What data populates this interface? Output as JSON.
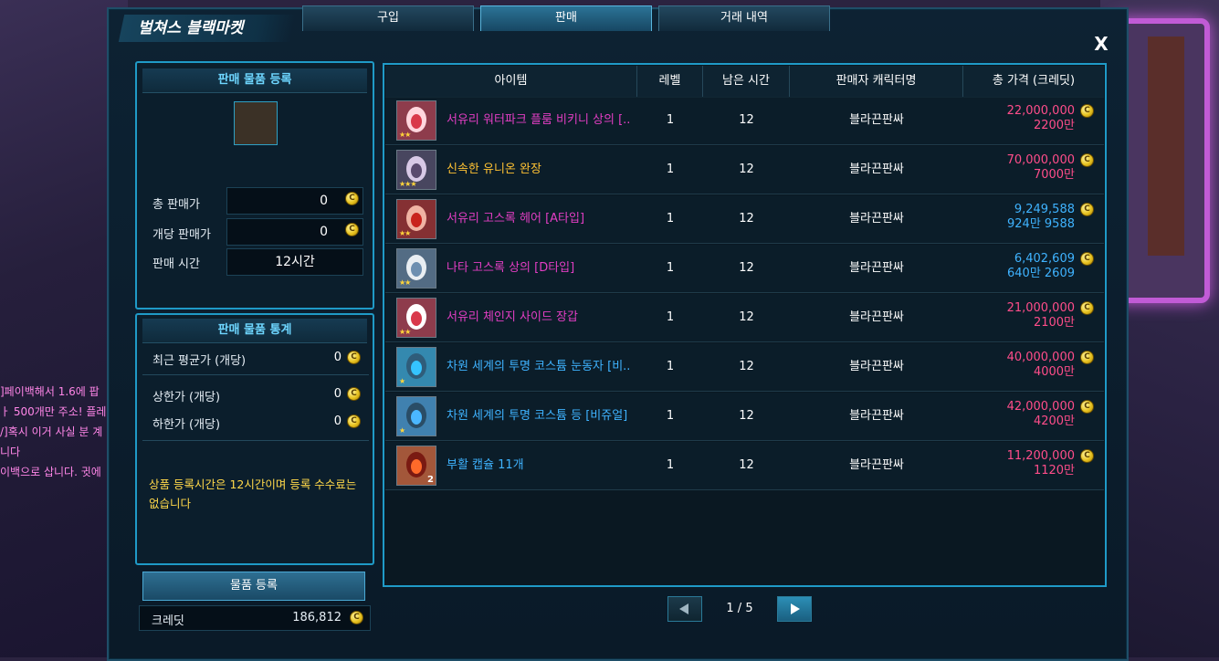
{
  "chat": [
    {
      "text": "]페이백해서 1.6에 팝",
      "pink": true
    },
    {
      "text": "ㅏ 500개만 주소! 플레",
      "pink": false
    },
    {
      "text": "/]혹시 이거 사실 분 계",
      "pink": false
    },
    {
      "text": "니다",
      "pink": false
    },
    {
      "text": "이백으로 삽니다. 귓에",
      "pink": false
    }
  ],
  "window": {
    "title": "벌쳐스 블랙마켓",
    "close": "X"
  },
  "tabs": [
    "구입",
    "판매",
    "거래 내역"
  ],
  "register": {
    "header": "판매 물품 등록",
    "total_price_label": "총 판매가",
    "total_price": "0",
    "unit_price_label": "개당 판매가",
    "unit_price": "0",
    "sale_time_label": "판매 시간",
    "sale_time": "12시간"
  },
  "stats": {
    "header": "판매 물품 통계",
    "recent_avg_label": "최근 평균가 (개당)",
    "recent_avg": "0",
    "upper_label": "상한가 (개당)",
    "upper": "0",
    "lower_label": "하한가 (개당)",
    "lower": "0"
  },
  "notice": "상품 등록시간은 12시간이며 등록 수수료는 없습니다",
  "register_button": "물품 등록",
  "credit": {
    "label": "크레딧",
    "value": "186,812"
  },
  "coin_glyph": "C",
  "table": {
    "headers": [
      "아이템",
      "레벨",
      "남은 시간",
      "판매자 캐릭터명",
      "총 가격 (크레딧)"
    ],
    "rows": [
      {
        "name": "서유리 워터파크 플룸 비키니 상의 [..",
        "name_color": "#e33ec4",
        "level": "1",
        "time": "12",
        "seller": "블라끈판싸",
        "price": "22,000,000",
        "price_short": "2200만",
        "price_color": "#ff4d8a",
        "icon": "bikini-top-icon",
        "stars": "★★",
        "qty": ""
      },
      {
        "name": "신속한 유니온 완장",
        "name_color": "#ffc233",
        "level": "1",
        "time": "12",
        "seller": "블라끈판싸",
        "price": "70,000,000",
        "price_short": "7000만",
        "price_color": "#ff4d8a",
        "icon": "armband-icon",
        "stars": "★★★",
        "qty": ""
      },
      {
        "name": "서유리 고스록 헤어 [A타입]",
        "name_color": "#e33ec4",
        "level": "1",
        "time": "12",
        "seller": "블라끈판싸",
        "price": "9,249,588",
        "price_short": "924만 9588",
        "price_color": "#3fb3ff",
        "icon": "red-hair-icon",
        "stars": "★★",
        "qty": ""
      },
      {
        "name": "나타 고스록 상의 [D타입]",
        "name_color": "#e33ec4",
        "level": "1",
        "time": "12",
        "seller": "블라끈판싸",
        "price": "6,402,609",
        "price_short": "640만 2609",
        "price_color": "#3fb3ff",
        "icon": "white-top-icon",
        "stars": "★★",
        "qty": ""
      },
      {
        "name": "서유리 체인지 사이드 장갑",
        "name_color": "#e33ec4",
        "level": "1",
        "time": "12",
        "seller": "블라끈판싸",
        "price": "21,000,000",
        "price_short": "2100만",
        "price_color": "#ff4d8a",
        "icon": "glove-icon",
        "stars": "★★",
        "qty": ""
      },
      {
        "name": "차원 세계의 투명 코스튬 눈동자 [비..",
        "name_color": "#3fb3ff",
        "level": "1",
        "time": "12",
        "seller": "블라끈판싸",
        "price": "40,000,000",
        "price_short": "4000만",
        "price_color": "#ff4d8a",
        "icon": "eye-costume-icon",
        "stars": "★",
        "qty": ""
      },
      {
        "name": "차원 세계의 투명 코스튬 등 [비쥬얼]",
        "name_color": "#3fb3ff",
        "level": "1",
        "time": "12",
        "seller": "블라끈판싸",
        "price": "42,000,000",
        "price_short": "4200만",
        "price_color": "#ff4d8a",
        "icon": "back-costume-icon",
        "stars": "★",
        "qty": ""
      },
      {
        "name": "부활 캡슐 11개",
        "name_color": "#3fb3ff",
        "level": "1",
        "time": "12",
        "seller": "블라끈판싸",
        "price": "11,200,000",
        "price_short": "1120만",
        "price_color": "#ff4d8a",
        "icon": "revive-capsule-icon",
        "stars": "",
        "qty": "2"
      }
    ]
  },
  "pager": {
    "text": "1 / 5",
    "prev": "◀",
    "next": "▶"
  }
}
